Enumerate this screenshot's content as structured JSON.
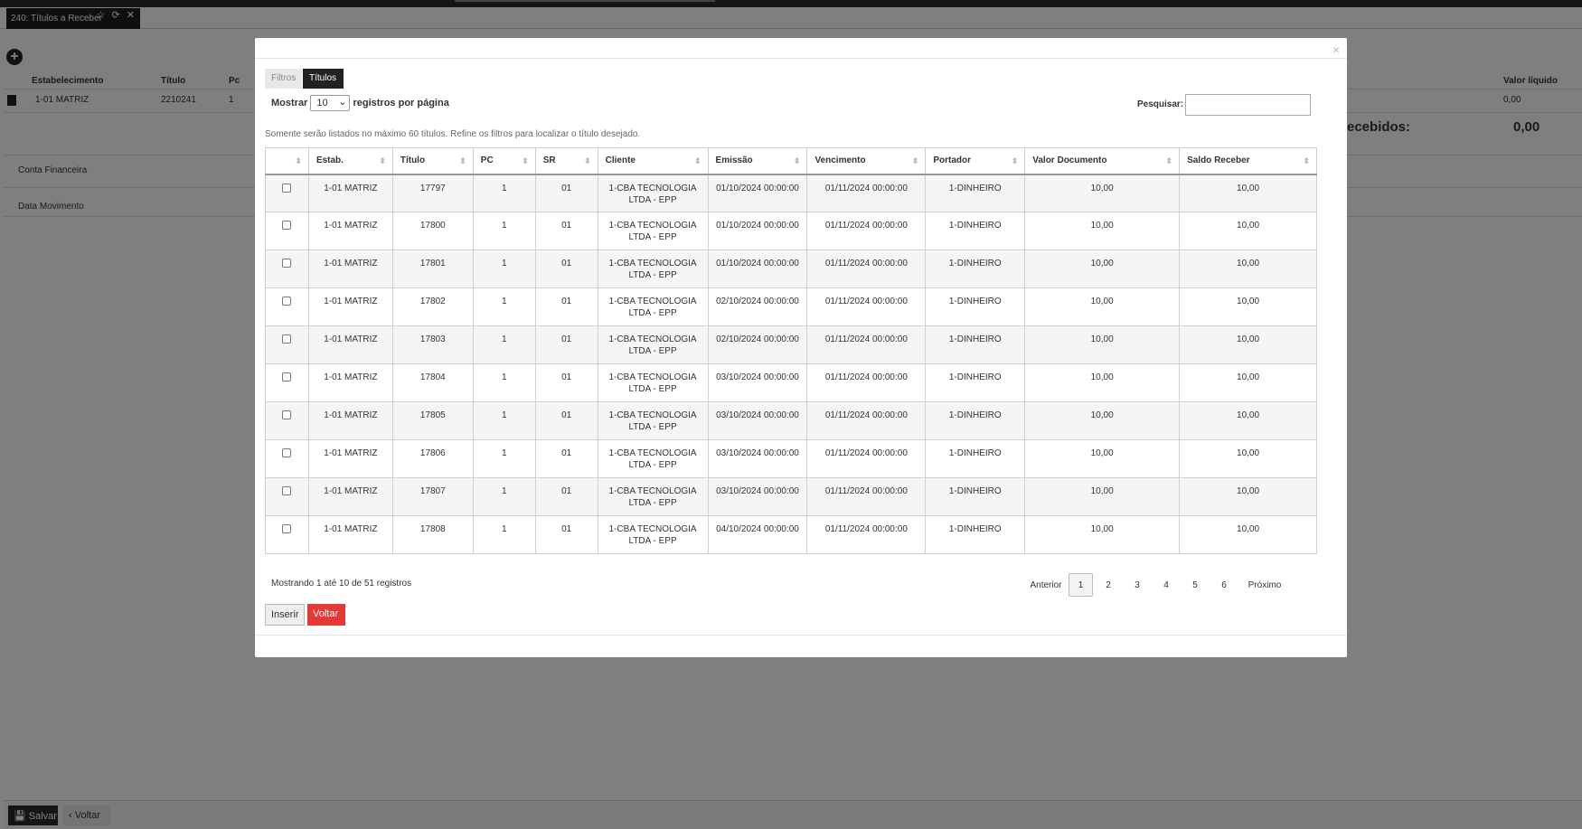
{
  "window": {
    "tab_title": "240: Títulos a Receber",
    "tab_icons": "☆ ⟳ ✕"
  },
  "background": {
    "add_icon": "+",
    "columns": [
      "Estabelecimento",
      "Título",
      "Pc",
      "Valor líquido"
    ],
    "row": {
      "estab": "1-01 MATRIZ",
      "titulo": "2210241",
      "pc": "1",
      "valor": "0,00"
    },
    "recebidos_label": "ecebidos:",
    "recebidos_value": "0,00",
    "fields": [
      "Conta Financeira",
      "Data Movimento"
    ],
    "save_label": "Salvar",
    "back_label": "Voltar"
  },
  "modal": {
    "close": "×",
    "tabs": [
      "Filtros",
      "Títulos"
    ],
    "show_label": "Mostrar",
    "show_value": "10",
    "show_suffix": "registros por página",
    "search_label": "Pesquisar:",
    "search_value": "",
    "note": "Somente serão listados no máximo 60 títulos. Refine os filtros para localizar o título desejado.",
    "columns": [
      "",
      "Estab.",
      "Título",
      "PC",
      "SR",
      "Cliente",
      "Emissão",
      "Vencimento",
      "Portador",
      "Valor Documento",
      "Saldo Receber"
    ],
    "rows": [
      {
        "estab": "1-01 MATRIZ",
        "titulo": "17797",
        "pc": "1",
        "sr": "01",
        "cliente1": "1-CBA TECNOLOGIA",
        "cliente2": "LTDA - EPP",
        "emissao": "01/10/2024 00:00:00",
        "vencimento": "01/11/2024 00:00:00",
        "portador": "1-DINHEIRO",
        "valor": "10,00",
        "saldo": "10,00"
      },
      {
        "estab": "1-01 MATRIZ",
        "titulo": "17800",
        "pc": "1",
        "sr": "01",
        "cliente1": "1-CBA TECNOLOGIA",
        "cliente2": "LTDA - EPP",
        "emissao": "01/10/2024 00:00:00",
        "vencimento": "01/11/2024 00:00:00",
        "portador": "1-DINHEIRO",
        "valor": "10,00",
        "saldo": "10,00"
      },
      {
        "estab": "1-01 MATRIZ",
        "titulo": "17801",
        "pc": "1",
        "sr": "01",
        "cliente1": "1-CBA TECNOLOGIA",
        "cliente2": "LTDA - EPP",
        "emissao": "01/10/2024 00:00:00",
        "vencimento": "01/11/2024 00:00:00",
        "portador": "1-DINHEIRO",
        "valor": "10,00",
        "saldo": "10,00"
      },
      {
        "estab": "1-01 MATRIZ",
        "titulo": "17802",
        "pc": "1",
        "sr": "01",
        "cliente1": "1-CBA TECNOLOGIA",
        "cliente2": "LTDA - EPP",
        "emissao": "02/10/2024 00:00:00",
        "vencimento": "01/11/2024 00:00:00",
        "portador": "1-DINHEIRO",
        "valor": "10,00",
        "saldo": "10,00"
      },
      {
        "estab": "1-01 MATRIZ",
        "titulo": "17803",
        "pc": "1",
        "sr": "01",
        "cliente1": "1-CBA TECNOLOGIA",
        "cliente2": "LTDA - EPP",
        "emissao": "02/10/2024 00:00:00",
        "vencimento": "01/11/2024 00:00:00",
        "portador": "1-DINHEIRO",
        "valor": "10,00",
        "saldo": "10,00"
      },
      {
        "estab": "1-01 MATRIZ",
        "titulo": "17804",
        "pc": "1",
        "sr": "01",
        "cliente1": "1-CBA TECNOLOGIA",
        "cliente2": "LTDA - EPP",
        "emissao": "03/10/2024 00:00:00",
        "vencimento": "01/11/2024 00:00:00",
        "portador": "1-DINHEIRO",
        "valor": "10,00",
        "saldo": "10,00"
      },
      {
        "estab": "1-01 MATRIZ",
        "titulo": "17805",
        "pc": "1",
        "sr": "01",
        "cliente1": "1-CBA TECNOLOGIA",
        "cliente2": "LTDA - EPP",
        "emissao": "03/10/2024 00:00:00",
        "vencimento": "01/11/2024 00:00:00",
        "portador": "1-DINHEIRO",
        "valor": "10,00",
        "saldo": "10,00"
      },
      {
        "estab": "1-01 MATRIZ",
        "titulo": "17806",
        "pc": "1",
        "sr": "01",
        "cliente1": "1-CBA TECNOLOGIA",
        "cliente2": "LTDA - EPP",
        "emissao": "03/10/2024 00:00:00",
        "vencimento": "01/11/2024 00:00:00",
        "portador": "1-DINHEIRO",
        "valor": "10,00",
        "saldo": "10,00"
      },
      {
        "estab": "1-01 MATRIZ",
        "titulo": "17807",
        "pc": "1",
        "sr": "01",
        "cliente1": "1-CBA TECNOLOGIA",
        "cliente2": "LTDA - EPP",
        "emissao": "03/10/2024 00:00:00",
        "vencimento": "01/11/2024 00:00:00",
        "portador": "1-DINHEIRO",
        "valor": "10,00",
        "saldo": "10,00"
      },
      {
        "estab": "1-01 MATRIZ",
        "titulo": "17808",
        "pc": "1",
        "sr": "01",
        "cliente1": "1-CBA TECNOLOGIA",
        "cliente2": "LTDA - EPP",
        "emissao": "04/10/2024 00:00:00",
        "vencimento": "01/11/2024 00:00:00",
        "portador": "1-DINHEIRO",
        "valor": "10,00",
        "saldo": "10,00"
      }
    ],
    "info": "Mostrando 1 até 10 de 51 registros",
    "pagination": {
      "prev": "Anterior",
      "pages": [
        "1",
        "2",
        "3",
        "4",
        "5",
        "6"
      ],
      "active": "1",
      "next": "Próximo"
    },
    "insert_label": "Inserir",
    "back_label": "Voltar"
  }
}
